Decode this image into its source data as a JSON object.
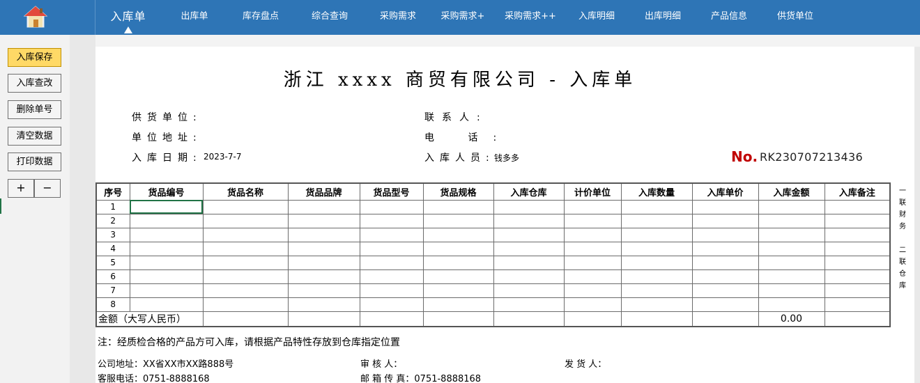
{
  "nav": {
    "tabs": [
      "入库单",
      "出库单",
      "库存盘点",
      "综合查询",
      "采购需求",
      "采购需求+",
      "采购需求++",
      "入库明细",
      "出库明细",
      "产品信息",
      "供货单位"
    ],
    "home_icon": "home-icon"
  },
  "sidebar": {
    "buttons": [
      "入库保存",
      "入库查改",
      "删除单号",
      "清空数据",
      "打印数据"
    ],
    "plus": "+",
    "minus": "−"
  },
  "form": {
    "title": "浙江 xxxx 商贸有限公司 - 入库单",
    "supplier_label": "供货单位:",
    "address_label": "单位地址:",
    "date_label": "入库日期:",
    "date_value": "2023-7-7",
    "contact_label": "联系人:",
    "phone_label": "电 话:",
    "staff_label": "入库人员:",
    "staff_value": "钱多多",
    "no_label": "No.",
    "no_value": "RK230707213436"
  },
  "table": {
    "headers": [
      "序号",
      "货品编号",
      "货品名称",
      "货品品牌",
      "货品型号",
      "货品规格",
      "入库仓库",
      "计价单位",
      "入库数量",
      "入库单价",
      "入库金额",
      "入库备注"
    ],
    "rows": [
      "1",
      "2",
      "3",
      "4",
      "5",
      "6",
      "7",
      "8"
    ],
    "total_label": "金额（大写人民币）",
    "total_amount": "0.00"
  },
  "side_note": [
    "一",
    "联",
    "财",
    "务",
    "",
    "二",
    "联",
    "仓",
    "库"
  ],
  "footer": {
    "note": "注：经质检合格的产品方可入库，请根据产品特性存放到仓库指定位置",
    "company_address": "公司地址：XX省XX市XX路888号",
    "service_phone": "客服电话：0751-8888168",
    "reviewer": "审 核 人：",
    "fax": "邮 箱 传 真：0751-8888168",
    "shipper": "发 货 人："
  },
  "colors": {
    "nav_bg": "#2e75b6",
    "active_button": "#ffd966",
    "no_label": "#c00000",
    "selection": "#217346"
  }
}
